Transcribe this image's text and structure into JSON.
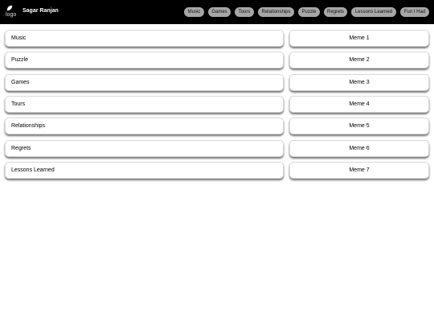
{
  "header": {
    "logo_alt": "logo",
    "site_name": "Sagar Ranjan",
    "nav": [
      "Music",
      "Games",
      "Tours",
      "Relationships",
      "Puzzle",
      "Regrets",
      "Lessons Learned",
      "Fun I Had"
    ]
  },
  "topics": [
    "Music",
    "Puzzle",
    "Games",
    "Tours",
    "Relationships",
    "Regrets",
    "Lessons Learned"
  ],
  "memes": [
    "Meme 1",
    "Meme 2",
    "Meme 3",
    "Meme 4",
    "Meme 5",
    "Meme 6",
    "Meme 7"
  ],
  "colors": {
    "header_bg": "#000000",
    "nav_pill_bg": "#a7a7a7",
    "card_bg": "#ffffff"
  }
}
